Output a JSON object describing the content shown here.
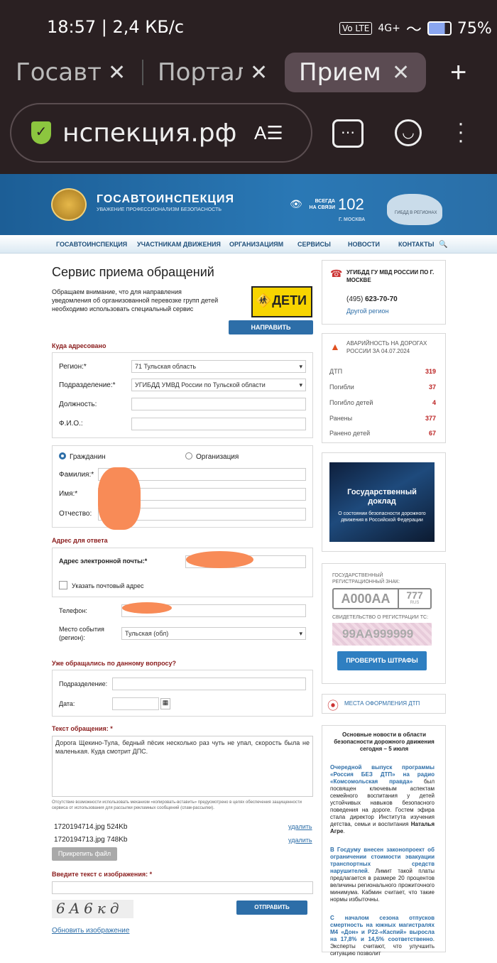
{
  "status_bar": {
    "time": "18:57 | 2,4 КБ/с",
    "battery": "75%",
    "network": "4G+"
  },
  "tabs": [
    {
      "label": "Госавтоинспекция"
    },
    {
      "label": "Портал"
    },
    {
      "label": "Прием"
    }
  ],
  "url": "нспекция.рф",
  "site": {
    "title": "ГОСАВТОИНСПЕКЦИЯ",
    "tagline": "УВАЖЕНИЕ ПРОФЕССИОНАЛИЗМ БЕЗОПАСНОСТЬ",
    "always": "ВСЕГДА НА СВЯЗИ",
    "phone": "102",
    "city": "Г. МОСКВА",
    "regions": "ГИБДД В РЕГИОНАХ"
  },
  "nav": [
    "ГОСАВТОИНСПЕКЦИЯ",
    "УЧАСТНИКАМ ДВИЖЕНИЯ",
    "ОРГАНИЗАЦИЯМ",
    "СЕРВИСЫ",
    "НОВОСТИ",
    "КОНТАКТЫ"
  ],
  "form": {
    "title": "Сервис приема обращений",
    "notice": "Обращаем внимание, что для направления уведомления об организованной перевозке групп детей необходимо использовать специальный сервис",
    "deti": "ДЕТИ",
    "notify_btn": "НАПРАВИТЬ УВЕДОМЛЕНИЕ",
    "to_section": "Куда адресовано",
    "region_label": "Регион:*",
    "region_value": "71 Тульская область",
    "dept_label": "Подразделение:*",
    "dept_value": "УГИБДД УМВД России по Тульской области",
    "position_label": "Должность:",
    "fio_label": "Ф.И.О.:",
    "citizen": "Гражданин",
    "organization": "Организация",
    "surname_label": "Фамилия:*",
    "name_label": "Имя:*",
    "patronymic_label": "Отчество:",
    "reply_section": "Адрес для ответа",
    "email_label": "Адрес электронной почты:*",
    "postal_label": "Указать почтовый адрес",
    "phone_label": "Телефон:",
    "place_label": "Место события (регион):",
    "place_value": "Тульская (обл)",
    "prev_section": "Уже обращались по данному вопросу?",
    "prev_dept_label": "Подразделение:",
    "prev_date_label": "Дата:",
    "text_section": "Текст обращения: *",
    "text_value": "Дорога Щекино-Тула, бедный пёсик несколько раз чуть не упал, скорость была не маленькая. Куда смотрит ДПС.",
    "copy_notice": "Отсутствие возможности использовать механизм «копировать-вставить» предусмотрено в целях обеспечения защищенности сервиса от использования для рассылки рекламных сообщений (спам-рассылки).",
    "files": [
      {
        "name": "1720194714.jpg 524Kb",
        "action": "удалить"
      },
      {
        "name": "1720194713.jpg 748Kb",
        "action": "удалить"
      }
    ],
    "attach_btn": "Прикрепить файл",
    "captcha_label": "Введите текст с изображения: *",
    "captcha_text": "6A6кд",
    "send_btn": "ОТПРАВИТЬ ОБРАЩЕНИЕ",
    "refresh_link": "Обновить изображение"
  },
  "sidebar": {
    "contact_title": "УГИБДД ГУ МВД РОССИИ ПО Г. МОСКВЕ",
    "contact_phone_prefix": "(495) ",
    "contact_phone": "623-70-70",
    "other_region": "Другой регион",
    "acc_title": "АВАРИЙНОСТЬ НА ДОРОГАХ РОССИИ ЗА 04.07.2024",
    "stats": [
      {
        "label": "ДТП",
        "value": "319"
      },
      {
        "label": "Погибли",
        "value": "37"
      },
      {
        "label": "Погибло детей",
        "value": "4"
      },
      {
        "label": "Ранены",
        "value": "377"
      },
      {
        "label": "Ранено детей",
        "value": "67"
      }
    ],
    "report_title": "Государственный доклад",
    "report_sub": "О состоянии безопасности дорожного движения в Российской Федерации",
    "plate_label": "ГОСУДАРСТВЕННЫЙ РЕГИСТРАЦИОННЫЙ ЗНАК:",
    "plate_value": "А000АА",
    "plate_region": "777",
    "plate_rus": "RUS",
    "cert_label": "СВИДЕТЕЛЬСТВО О РЕГИСТРАЦИИ ТС:",
    "cert_value": "99АА999999",
    "check_btn": "ПРОВЕРИТЬ ШТРАФЫ",
    "dtp_places": "МЕСТА ОФОРМЛЕНИЯ ДТП",
    "news_title": "Основные новости в области безопасности дорожного движения сегодня – 5 июля",
    "news": [
      {
        "link": "Очередной выпуск программы «Россия БЕЗ ДТП» на радио «Комсомольская правда»",
        "text": " был посвящен ключевым аспектам семейного воспитания у детей устойчивых навыков безопасного поведения на дороге. Гостем эфира стала директор Института изучения детства, семьи и воспитания ",
        "bold": "Наталья Агре",
        "end": "."
      },
      {
        "link": "В Госдуму внесен законопроект об ограничении стоимости эвакуации транспортных средств нарушителей",
        "text": ". Лимит такой платы предлагается в размере 20 процентов величины регионального прожиточного минимума. Кабмин считает, что такие нормы избыточны.",
        "bold": "",
        "end": ""
      },
      {
        "link": "С началом сезона отпусков смертность на южных магистралях М4 «Дон» и Р22-«Каспий» выросла на 17,8% и 14,5% соответственно",
        "text": ". Эксперты считают, что улучшить ситуацию позволит",
        "bold": "",
        "end": ""
      }
    ]
  }
}
